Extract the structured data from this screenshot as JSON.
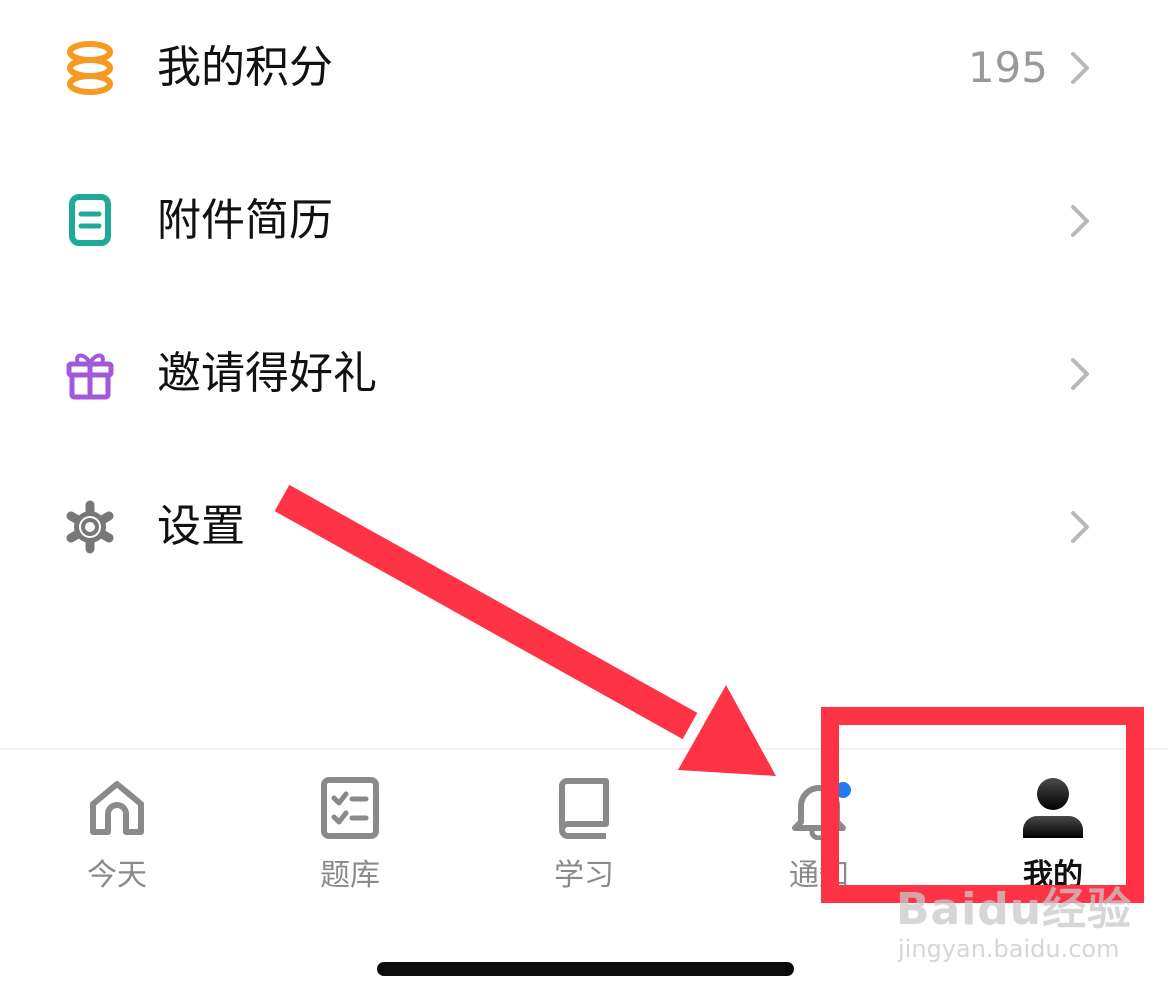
{
  "menu": {
    "items": [
      {
        "label": "我的积分",
        "value": "195",
        "icon": "coins-icon",
        "color": "#F59A23"
      },
      {
        "label": "附件简历",
        "value": "",
        "icon": "document-icon",
        "color": "#1EAA96"
      },
      {
        "label": "邀请得好礼",
        "value": "",
        "icon": "gift-icon",
        "color": "#A259D9"
      },
      {
        "label": "设置",
        "value": "",
        "icon": "gear-icon",
        "color": "#777777"
      }
    ]
  },
  "tabbar": {
    "tabs": [
      {
        "label": "今天",
        "icon": "home-icon"
      },
      {
        "label": "题库",
        "icon": "checklist-icon"
      },
      {
        "label": "学习",
        "icon": "book-icon"
      },
      {
        "label": "通知",
        "icon": "bell-icon",
        "badge_color": "#1E7BF2"
      },
      {
        "label": "我的",
        "icon": "person-icon",
        "active": true
      }
    ]
  },
  "annotation": {
    "color": "#FF3346"
  },
  "watermark": {
    "main": "Baidu经验",
    "sub": "jingyan.baidu.com"
  }
}
